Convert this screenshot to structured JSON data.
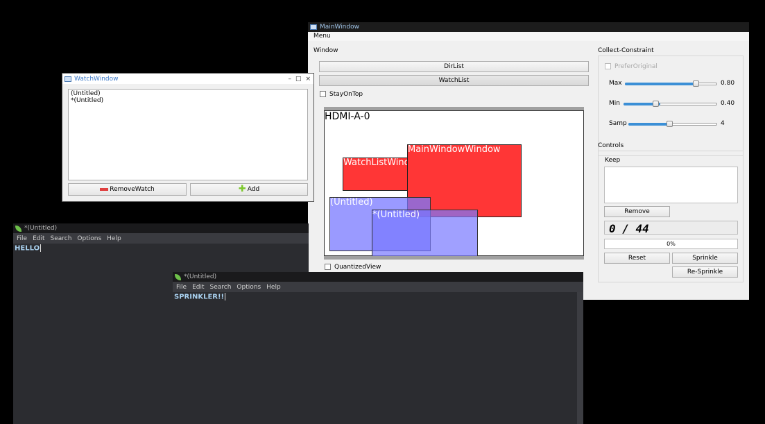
{
  "main_window": {
    "title": "MainWindow",
    "menu": "Menu",
    "window_group": "Window",
    "dirlist_button": "DirList",
    "watchlist_button": "WatchList",
    "stay_on_top_label": "StayOnTop",
    "quantized_view_label": "QuantizedView",
    "preview": {
      "monitor_label": "HDMI-A-0",
      "rects": [
        {
          "label": "WatchListWindow",
          "kind": "red"
        },
        {
          "label": "MainWindowWindow",
          "kind": "red"
        },
        {
          "label": "(Untitled)",
          "kind": "blue"
        },
        {
          "label": "*(Untitled)",
          "kind": "blue"
        }
      ]
    },
    "collect_constraint": {
      "title": "Collect-Constraint",
      "prefer_original_label": "PreferOriginal",
      "max_label": "Max",
      "max_value": "0.80",
      "max_fraction": 0.8,
      "min_label": "Min",
      "min_value": "0.40",
      "min_fraction": 0.4,
      "samp_label": "Samp",
      "samp_value": "4",
      "samp_fraction": 0.4
    },
    "controls": {
      "title": "Controls",
      "keep_label": "Keep",
      "remove_button": "Remove",
      "counter": "0 / 44",
      "progress_text": "0%",
      "progress_fraction": 0,
      "reset_button": "Reset",
      "sprinkle_button": "Sprinkle",
      "resprinkle_button": "Re-Sprinkle"
    }
  },
  "watch_window": {
    "title": "WatchWindow",
    "items": [
      "(Untitled)",
      "*(Untitled)"
    ],
    "remove_button": "RemoveWatch",
    "add_button": "Add"
  },
  "editor1": {
    "title": "*(Untitled)",
    "menu": [
      "File",
      "Edit",
      "Search",
      "Options",
      "Help"
    ],
    "text": "HELLO"
  },
  "editor2": {
    "title": "*(Untitled)",
    "menu": [
      "File",
      "Edit",
      "Search",
      "Options",
      "Help"
    ],
    "text": "SPRINKLER!!"
  },
  "colors": {
    "red_rect": "#ff3636",
    "blue_rect": "#8c8cff",
    "slider_fill": "#3b8fd6",
    "editor_bg": "#2b2c30"
  }
}
